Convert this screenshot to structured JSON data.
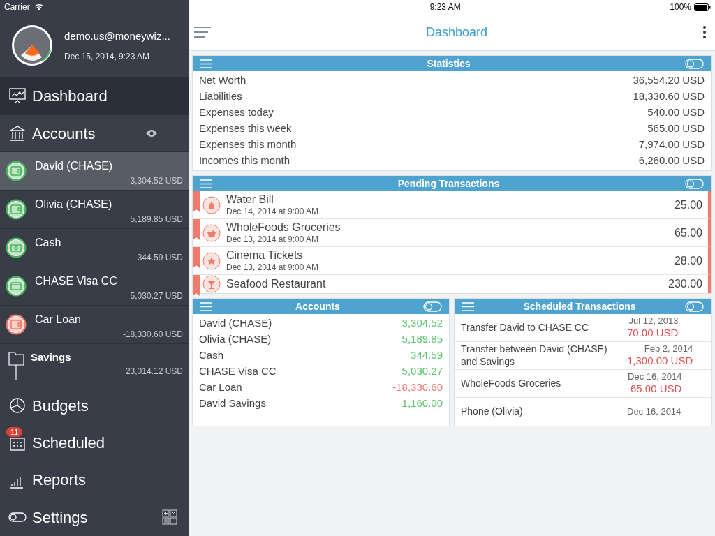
{
  "status_bar": {
    "carrier": "Carrier",
    "time": "9:23 AM",
    "battery": "100%"
  },
  "profile": {
    "email": "demo.us@moneywiz...",
    "date": "Dec 15, 2014, 9:23 AM"
  },
  "nav_top": [
    {
      "kind": "dashboard",
      "label": "Dashboard",
      "selected": true
    },
    {
      "kind": "accounts",
      "label": "Accounts",
      "selected": false
    }
  ],
  "accounts": [
    {
      "kind": "wallet",
      "name": "David (CHASE)",
      "balance": "3,304.52 USD",
      "color": "#4cb45e",
      "selected": true
    },
    {
      "kind": "wallet",
      "name": "Olivia (CHASE)",
      "balance": "5,189.85 USD",
      "color": "#4cb45e",
      "selected": false
    },
    {
      "kind": "cash",
      "name": "Cash",
      "balance": "344.59 USD",
      "color": "#4cb45e",
      "selected": false
    },
    {
      "kind": "card",
      "name": "CHASE Visa CC",
      "balance": "5,030.27 USD",
      "color": "#4cb45e",
      "selected": false
    },
    {
      "kind": "wallet",
      "name": "Car Loan",
      "balance": "-18,330.60 USD",
      "color": "#ee7b6b",
      "selected": false
    }
  ],
  "group": {
    "name": "Savings",
    "balance": "23,014.12 USD"
  },
  "nav_bottom": [
    {
      "kind": "budgets",
      "label": "Budgets"
    },
    {
      "kind": "scheduled",
      "label": "Scheduled",
      "badge": "11"
    },
    {
      "kind": "reports",
      "label": "Reports"
    },
    {
      "kind": "settings",
      "label": "Settings"
    }
  ],
  "header": {
    "title": "Dashboard"
  },
  "statistics": {
    "title": "Statistics",
    "rows": [
      {
        "label": "Net Worth",
        "value": "36,554.20 USD"
      },
      {
        "label": "Liabilities",
        "value": "18,330.60 USD"
      },
      {
        "label": "Expenses today",
        "value": "540.00 USD"
      },
      {
        "label": "Expenses this week",
        "value": "565.00 USD"
      },
      {
        "label": "Expenses this month",
        "value": "7,974.00 USD"
      },
      {
        "label": "Incomes this month",
        "value": "6,260.00 USD"
      }
    ]
  },
  "pending": {
    "title": "Pending Transactions",
    "rows": [
      {
        "kind": "drop",
        "name": "Water Bill",
        "date": "Dec 14, 2014 at 9:00 AM",
        "amount": "25.00"
      },
      {
        "kind": "basket",
        "name": "WholeFoods Groceries",
        "date": "Dec 13, 2014 at 9:00 AM",
        "amount": "65.00"
      },
      {
        "kind": "star",
        "name": "Cinema Tickets",
        "date": "Dec 13, 2014 at 9:00 AM",
        "amount": "28.00"
      },
      {
        "kind": "glass",
        "name": "Seafood Restaurant",
        "amount": "230.00"
      }
    ]
  },
  "accounts_panel": {
    "title": "Accounts",
    "rows": [
      {
        "name": "David (CHASE)",
        "value": "3,304.52",
        "negative": false
      },
      {
        "name": "Olivia (CHASE)",
        "value": "5,189.85",
        "negative": false
      },
      {
        "name": "Cash",
        "value": "344.59",
        "negative": false
      },
      {
        "name": "CHASE Visa CC",
        "value": "5,030.27",
        "negative": false
      },
      {
        "name": "Car Loan",
        "value": "-18,330.60",
        "negative": true
      },
      {
        "name": "David Savings",
        "value": "1,160.00",
        "negative": false
      }
    ]
  },
  "scheduled": {
    "title": "Scheduled Transactions",
    "rows": [
      {
        "name": "Transfer David to CHASE CC",
        "date": "Jul 12, 2013",
        "amount": "70.00 USD"
      },
      {
        "name": "Transfer between David (CHASE) and Savings",
        "date": "Feb 2, 2014",
        "amount": "1,300.00 USD"
      },
      {
        "name": "WholeFoods Groceries",
        "date": "Dec 16, 2014",
        "amount": "-65.00 USD"
      },
      {
        "name": "Phone (Olivia)",
        "date": "Dec 16, 2014"
      }
    ]
  }
}
